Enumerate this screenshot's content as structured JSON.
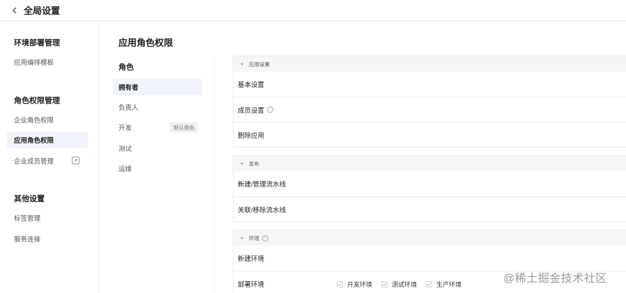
{
  "header": {
    "title": "全局设置"
  },
  "sidebar": {
    "groups": [
      {
        "title": "环境部署管理",
        "items": [
          {
            "label": "应用编排模板"
          }
        ]
      },
      {
        "title": "角色权限管理",
        "items": [
          {
            "label": "企业角色权限"
          },
          {
            "label": "应用角色权限"
          },
          {
            "label": "企业成员管理"
          }
        ]
      },
      {
        "title": "其他设置",
        "items": [
          {
            "label": "标签管理"
          },
          {
            "label": "服务连接"
          }
        ]
      }
    ]
  },
  "main": {
    "title": "应用角色权限",
    "roles_header": "角色",
    "roles": [
      {
        "label": "拥有者"
      },
      {
        "label": "负责人"
      },
      {
        "label": "开发",
        "badge": "默认角色"
      },
      {
        "label": "测试"
      },
      {
        "label": "运维"
      }
    ],
    "sections": [
      {
        "title": "应用设置",
        "rows": [
          {
            "label": "基本设置"
          },
          {
            "label": "成员设置"
          },
          {
            "label": "删除应用"
          }
        ]
      },
      {
        "title": "发布",
        "rows": [
          {
            "label": "新建/管理流水线"
          },
          {
            "label": "关联/移除流水线"
          }
        ]
      },
      {
        "title": "环境",
        "rows": [
          {
            "label": "新建环境"
          },
          {
            "label": "部署环境"
          }
        ]
      }
    ],
    "env_checks": [
      {
        "label": "开发环境"
      },
      {
        "label": "测试环境"
      },
      {
        "label": "生产环境"
      }
    ]
  },
  "watermark": "@稀土掘金技术社区"
}
